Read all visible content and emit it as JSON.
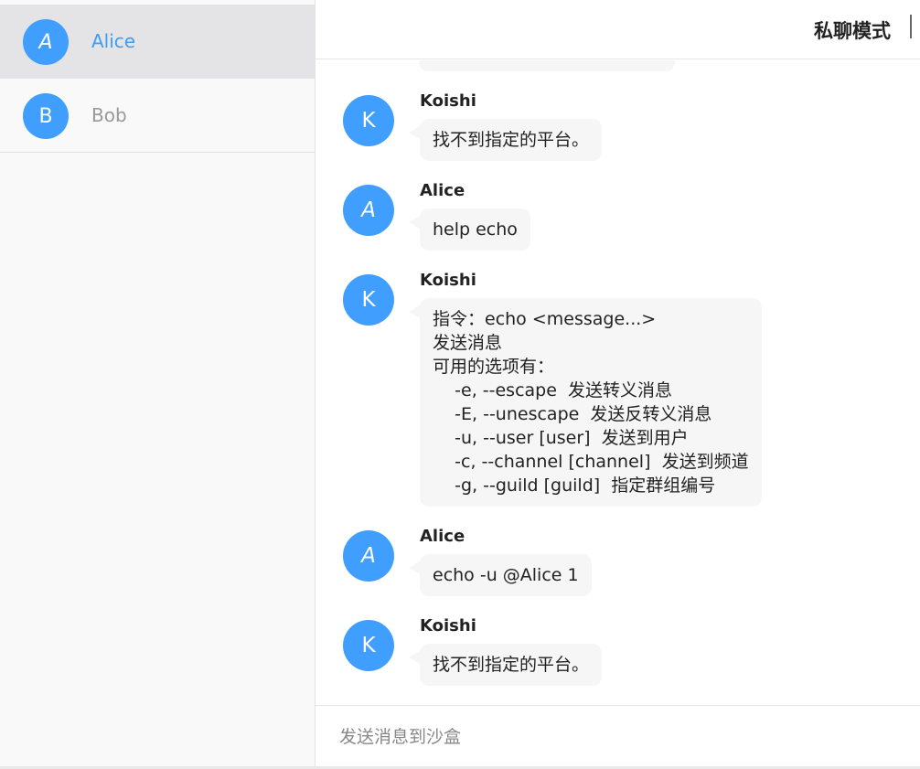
{
  "header": {
    "title": "私聊模式"
  },
  "users": [
    {
      "initial": "A",
      "name": "Alice",
      "active": true
    },
    {
      "initial": "B",
      "name": "Bob",
      "active": false
    }
  ],
  "messages": [
    {
      "author": "Koishi",
      "initial": "K",
      "lines": [
        "找不到指定的平台。"
      ]
    },
    {
      "author": "Alice",
      "initial": "A",
      "lines": [
        "help echo"
      ]
    },
    {
      "author": "Koishi",
      "initial": "K",
      "lines": [
        "指令：echo <message...>",
        "发送消息",
        "可用的选项有：",
        "    -e, --escape  发送转义消息",
        "    -E, --unescape  发送反转义消息",
        "    -u, --user [user]  发送到用户",
        "    -c, --channel [channel]  发送到频道",
        "    -g, --guild [guild]  指定群组编号"
      ]
    },
    {
      "author": "Alice",
      "initial": "A",
      "lines": [
        "echo -u @Alice 1"
      ]
    },
    {
      "author": "Koishi",
      "initial": "K",
      "lines": [
        "找不到指定的平台。"
      ]
    }
  ],
  "composer": {
    "placeholder": "发送消息到沙盒"
  },
  "colors": {
    "accent": "#409eff",
    "active_name": "#3e9df4",
    "bubble": "#f6f6f6",
    "sidebar": "#f9f9f9",
    "active_row": "#e4e4e6"
  }
}
